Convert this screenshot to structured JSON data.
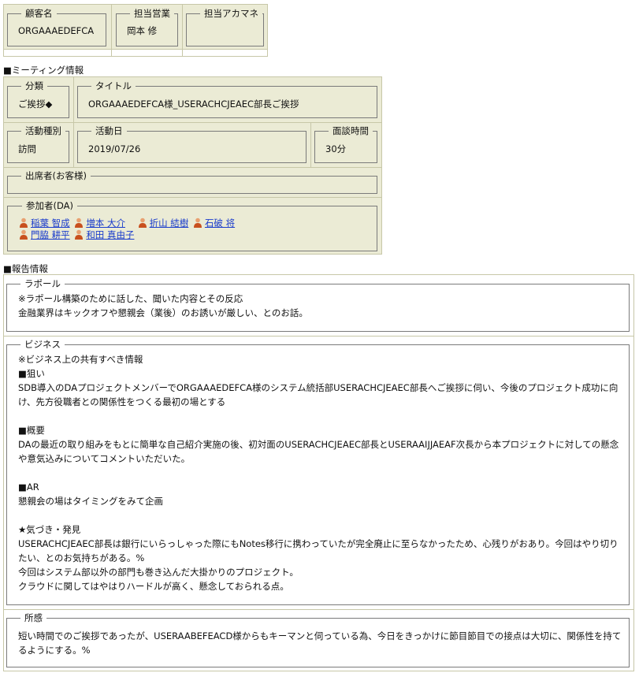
{
  "customer": {
    "name_label": "顧客名",
    "name_value": "ORGAAAEDEFCA",
    "sales_label": "担当営業",
    "sales_value": "岡本 修",
    "ac_label": "担当アカマネ",
    "ac_value": ""
  },
  "meeting": {
    "heading": "■ミーティング情報",
    "category_label": "分類",
    "category_value": "ご挨拶◆",
    "title_label": "タイトル",
    "title_value": "ORGAAAEDEFCA様_USERACHCJEAEC部長ご挨拶",
    "activity_type_label": "活動種別",
    "activity_type_value": "訪問",
    "activity_date_label": "活動日",
    "activity_date_value": "2019/07/26",
    "duration_label": "面談時間",
    "duration_value": "30分",
    "attendees_customer_label": "出席者(お客様)",
    "participants_label": "参加者(DA)",
    "participants": [
      "稲葉 智成",
      "増本 大介",
      "折山 結樹",
      "石破 将",
      "門脇 耕平",
      "和田 真由子"
    ]
  },
  "report": {
    "heading": "■報告情報",
    "rapport_label": "ラポール",
    "rapport_text": "※ラポール構築のために話した、聞いた内容とその反応\n金融業界はキックオフや懇親会（業後）のお誘いが厳しい、とのお話。",
    "business_label": "ビジネス",
    "business_text": "※ビジネス上の共有すべき情報\n■狙い\nSDB導入のDAプロジェクトメンバーでORGAAAEDEFCA様のシステム統括部USERACHCJEAEC部長へご挨拶に伺い、今後のプロジェクト成功に向け、先方役職者との関係性をつくる最初の場とする\n\n■概要\nDAの最近の取り組みをもとに簡単な自己紹介実施の後、初対面のUSERACHCJEAEC部長とUSERAAIJJAEAF次長から本プロジェクトに対しての懸念や意気込みについてコメントいただいた。\n\n■AR\n懇親会の場はタイミングをみて企画\n\n★気づき・発見\nUSERACHCJEAEC部長は銀行にいらっしゃった際にもNotes移行に携わっていたが完全廃止に至らなかったため、心残りがおあり。今回はやり切りたい、とのお気持ちがある。%\n今回はシステム部以外の部門も巻き込んだ大掛かりのプロジェクト。\nクラウドに関してはやはりハードルが高く、懸念しておられる点。",
    "impression_label": "所感",
    "impression_text": "短い時間でのご挨拶であったが、USERAABEFEACD様からもキーマンと伺っている為、今日をきっかけに節目節目での接点は大切に、関係性を持てるようにする。%"
  },
  "colors": {
    "panel_bg": "#ebebd5",
    "panel_border": "#c7c7a8",
    "link": "#1a3ccc"
  },
  "icons": {
    "participant": "person-icon"
  }
}
